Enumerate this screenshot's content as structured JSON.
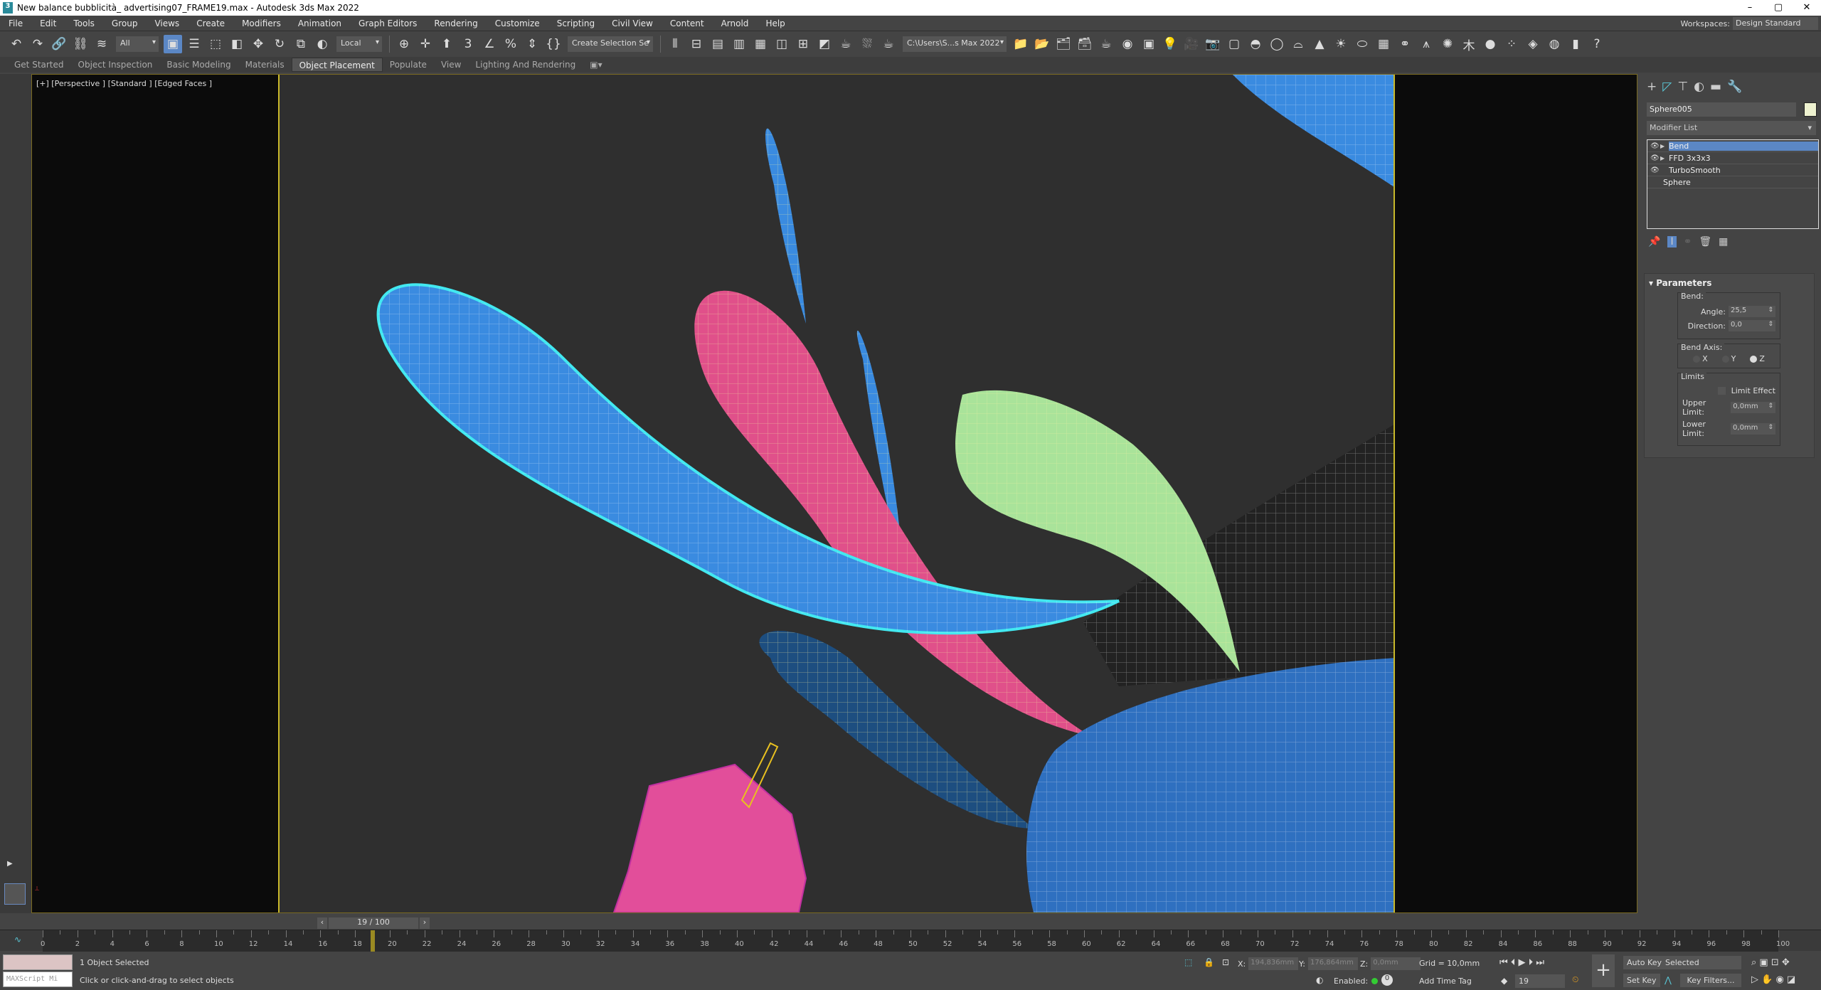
{
  "title": "New balance bubblicità_ advertising07_FRAME19.max - Autodesk 3ds Max 2022",
  "window_controls": [
    "–",
    "▢",
    "✕"
  ],
  "menu": [
    "File",
    "Edit",
    "Tools",
    "Group",
    "Views",
    "Create",
    "Modifiers",
    "Animation",
    "Graph Editors",
    "Rendering",
    "Customize",
    "Scripting",
    "Civil View",
    "Content",
    "Arnold",
    "Help"
  ],
  "workspaces": {
    "label": "Workspaces:",
    "value": "Design Standard"
  },
  "toolbar": {
    "selection_filter": "All",
    "coord_system": "Local",
    "named_selection": "Create Selection Se",
    "project_path": "C:\\Users\\S...s Max 2022",
    "icons_a": [
      [
        "undo-icon",
        "↶"
      ],
      [
        "redo-icon",
        "↷"
      ],
      [
        "link-icon",
        "🔗"
      ],
      [
        "unlink-icon",
        "⛓"
      ],
      [
        "bind-space-warp-icon",
        "≋"
      ]
    ],
    "icons_b": [
      [
        "select-object-icon",
        "▣"
      ],
      [
        "select-by-name-icon",
        "☰"
      ],
      [
        "rectangular-selection-icon",
        "⬚"
      ],
      [
        "window-crossing-icon",
        "◧"
      ],
      [
        "move-icon",
        "✥"
      ],
      [
        "rotate-icon",
        "↻"
      ],
      [
        "scale-icon",
        "⧉"
      ],
      [
        "placement-icon",
        "◐"
      ]
    ],
    "icons_c": [
      [
        "pivot-icon",
        "⊕"
      ],
      [
        "select-manipulate-icon",
        "✛"
      ],
      [
        "keyboard-shortcut-icon",
        "⬆"
      ],
      [
        "snap-3d-icon",
        "3"
      ],
      [
        "angle-snap-icon",
        "∠"
      ],
      [
        "percent-snap-icon",
        "%"
      ],
      [
        "spinner-snap-icon",
        "⇕"
      ],
      [
        "edit-named-sets-icon",
        "{}"
      ]
    ],
    "icons_d": [
      [
        "mirror-icon",
        "⫴"
      ],
      [
        "align-icon",
        "⊟"
      ],
      [
        "scene-explorer-icon",
        "▤"
      ],
      [
        "layer-explorer-icon",
        "▥"
      ],
      [
        "toggle-ribbon-icon",
        "▦"
      ],
      [
        "curve-editor-icon",
        "◫"
      ],
      [
        "schematic-view-icon",
        "⊞"
      ],
      [
        "material-editor-icon",
        "◩"
      ],
      [
        "render-setup-icon",
        "☕"
      ],
      [
        "render-frame-icon",
        "⛆"
      ],
      [
        "render-icon",
        "☕"
      ]
    ],
    "icons_e": [
      [
        "project-folder-icon",
        "📁"
      ],
      [
        "project-open-icon",
        "📂"
      ],
      [
        "project-tree-icon",
        "🗂"
      ],
      [
        "project-settings-icon",
        "🗃"
      ],
      [
        "render-teapot-icon",
        "☕"
      ],
      [
        "arnold-render-icon",
        "◉"
      ],
      [
        "render-window-icon",
        "▣"
      ],
      [
        "light-icon",
        "💡"
      ],
      [
        "camera-tools-icon",
        "🎥"
      ],
      [
        "camera-icon",
        "📷"
      ],
      [
        "box-icon",
        "▢"
      ],
      [
        "dome-icon",
        "◓"
      ],
      [
        "sphere-light-icon",
        "◯"
      ],
      [
        "basket-icon",
        "⌓"
      ],
      [
        "cone-icon",
        "▲"
      ],
      [
        "sun-icon",
        "☀"
      ],
      [
        "disc-icon",
        "⬭"
      ],
      [
        "grid-icon",
        "▦"
      ],
      [
        "molecule-icon",
        "⚭"
      ],
      [
        "tower-icon",
        "⩚"
      ],
      [
        "cog-icon",
        "✺"
      ],
      [
        "grass-icon",
        "⽊"
      ],
      [
        "globe-icon",
        "●"
      ],
      [
        "dots-icon",
        "⁘"
      ],
      [
        "purple-app-icon",
        "◈"
      ],
      [
        "blue-app-icon",
        "◍"
      ],
      [
        "batch-render-icon",
        "▮"
      ],
      [
        "help-icon",
        "?"
      ]
    ]
  },
  "ribbon": {
    "tabs": [
      "Get Started",
      "Object Inspection",
      "Basic Modeling",
      "Materials",
      "Object Placement",
      "Populate",
      "View",
      "Lighting And Rendering"
    ],
    "active": "Object Placement"
  },
  "viewport": {
    "label": "[+] [Perspective ] [Standard ] [Edged Faces ]"
  },
  "command_panel": {
    "tabs": [
      [
        "create-icon",
        "+"
      ],
      [
        "modify-icon",
        "◸"
      ],
      [
        "hierarchy-icon",
        "⊤"
      ],
      [
        "motion-icon",
        "◐"
      ],
      [
        "display-icon",
        "▬"
      ],
      [
        "utilities-icon",
        "🔧"
      ]
    ],
    "object_name": "Sphere005",
    "object_color": "#eef2d0",
    "modifier_list": "Modifier List",
    "stack": [
      {
        "label": "Bend",
        "eye": true,
        "expand": true,
        "selected": true
      },
      {
        "label": "FFD 3x3x3",
        "eye": true,
        "expand": true
      },
      {
        "label": "TurboSmooth",
        "eye": true
      },
      {
        "label": "Sphere"
      }
    ],
    "parameters": {
      "title": "Parameters",
      "bend_group": "Bend:",
      "angle_label": "Angle:",
      "angle": "25,5",
      "direction_label": "Direction:",
      "direction": "0,0",
      "axis_group": "Bend Axis:",
      "axes": [
        "X",
        "Y",
        "Z"
      ],
      "axis_selected": "Z",
      "limits_group": "Limits",
      "limit_effect": "Limit Effect",
      "limit_effect_checked": false,
      "upper_label": "Upper Limit:",
      "upper": "0,0mm",
      "lower_label": "Lower Limit:",
      "lower": "0,0mm"
    }
  },
  "time": {
    "frame_display": "19 / 100",
    "current_frame": 19,
    "start": 0,
    "end": 100,
    "label_step": 2
  },
  "status": {
    "selected": "1 Object Selected",
    "prompt": "Click or click-and-drag to select objects",
    "maxscript": "MAXScript Mi",
    "x_label": "X:",
    "x": "194,836mm",
    "y_label": "Y:",
    "y": "176,864mm",
    "z_label": "Z:",
    "z": "0,0mm",
    "grid": "Grid = 10,0mm",
    "enabled_label": "Enabled:",
    "add_time_tag": "Add Time Tag",
    "frame": "19",
    "auto_key": "Auto Key",
    "set_key": "Set Key",
    "key_mode": "Selected",
    "key_filters": "Key Filters..."
  },
  "colors": {
    "accent": "#5b87c5",
    "safe_frame": "#c9b92a",
    "blue_obj": "#3a8be0",
    "pink_obj": "#e0508a",
    "green_obj": "#a9e39a",
    "selection": "#42e8f0"
  }
}
